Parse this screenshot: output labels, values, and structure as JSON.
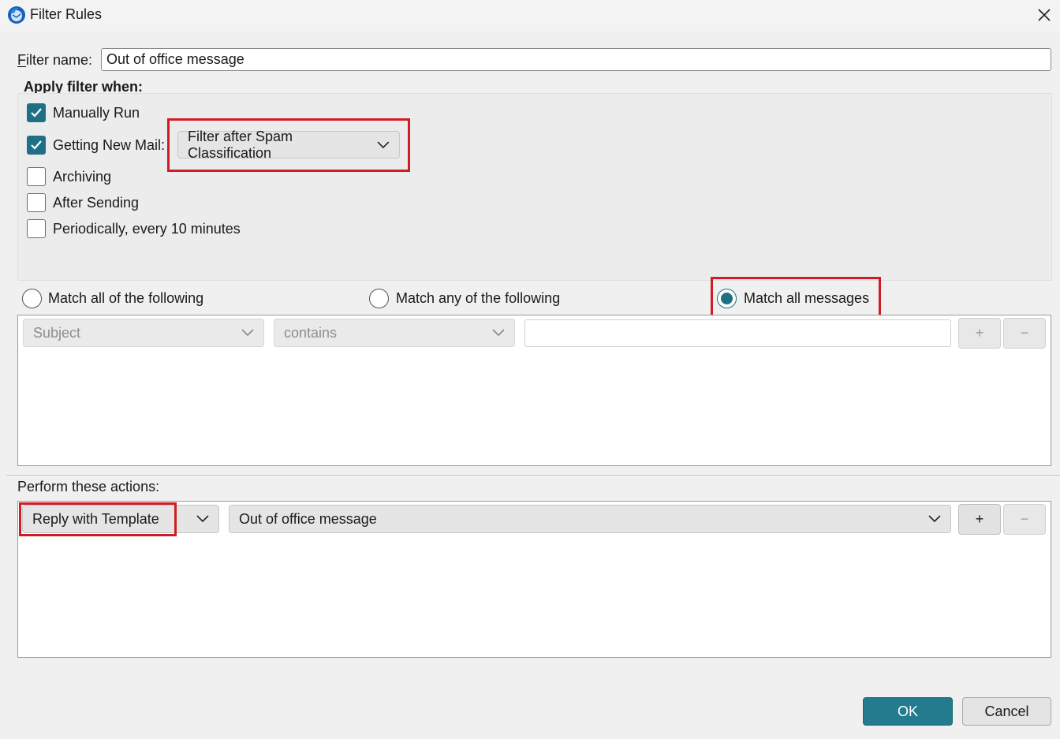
{
  "window": {
    "title": "Filter Rules",
    "icon": "thunderbird-app-icon",
    "close_icon": "close-icon"
  },
  "filter_name": {
    "label": "Filter name:",
    "value": "Out of office message"
  },
  "apply": {
    "heading": "Apply filter when:",
    "manually_run": {
      "label": "Manually Run",
      "checked": true
    },
    "getting_new_mail": {
      "label": "Getting New Mail:",
      "checked": true,
      "option": "Filter after Spam Classification"
    },
    "archiving": {
      "label": "Archiving",
      "checked": false
    },
    "after_sending": {
      "label": "After Sending",
      "checked": false
    },
    "periodically": {
      "label": "Periodically, every 10 minutes",
      "checked": false
    }
  },
  "match": {
    "all_following": "Match all of the following",
    "any_following": "Match any of the following",
    "all_messages": "Match all messages",
    "selected": "all_messages"
  },
  "criteria": {
    "field": "Subject",
    "operator": "contains",
    "value": "",
    "add": "+",
    "remove": "−"
  },
  "actions": {
    "label": "Perform these actions:",
    "action": "Reply with Template",
    "template": "Out of office message",
    "add": "+",
    "remove": "−"
  },
  "buttons": {
    "ok": "OK",
    "cancel": "Cancel"
  },
  "colors": {
    "accent": "#1f6f85",
    "highlight": "#d01c24"
  }
}
